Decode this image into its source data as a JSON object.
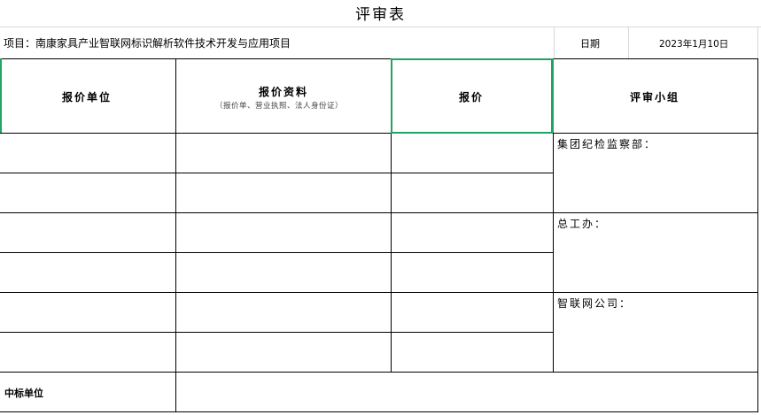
{
  "sheet": {
    "title": "评审表",
    "project_line": "项目：南康家具产业智联网标识解析软件技术开发与应用项目",
    "date_label": "日期",
    "date_value": "2023年1月10日"
  },
  "table": {
    "headers": {
      "unit": "报价单位",
      "docs": "报价资料",
      "docs_note": "（报价单、营业执照、法人身份证）",
      "price": "报价",
      "panel": "评审小组"
    },
    "panel_members": [
      "集团纪检监察部：",
      "总工办：",
      "智联网公司："
    ],
    "winner_label": "中标单位"
  },
  "colors": {
    "grid_light": "#d9d9d9",
    "border": "#000000",
    "selection": "#21a366"
  }
}
